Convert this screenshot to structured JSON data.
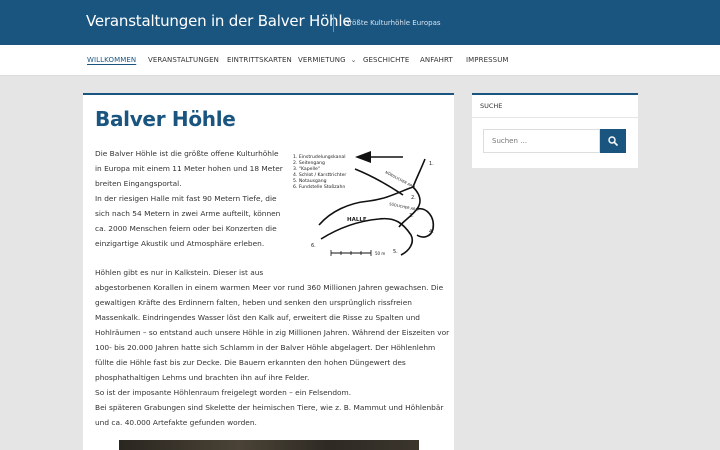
{
  "site": {
    "title": "Veranstaltungen in der Balver Höhle",
    "tagline": "Größte Kulturhöhle Europas"
  },
  "nav": {
    "items": [
      {
        "label": "WILLKOMMEN",
        "active": true
      },
      {
        "label": "VERANSTALTUNGEN"
      },
      {
        "label": "EINTRITTSKARTEN"
      },
      {
        "label": "VERMIETUNG",
        "has_dropdown": true
      },
      {
        "label": "GESCHICHTE"
      },
      {
        "label": "ANFAHRT"
      },
      {
        "label": "IMPRESSUM"
      }
    ]
  },
  "page": {
    "title": "Balver Höhle",
    "intro_lines": [
      "Die Balver Höhle ist die größte offene Kulturhöhle",
      "in Europa mit einem 11 Meter hohen und 18 Meter",
      "breiten Eingangsportal.",
      "In der riesigen Halle mit fast 90 Metern Tiefe, die",
      "sich nach 54 Metern in zwei Arme aufteilt, können",
      "ca. 2000 Menschen feiern oder bei Konzerten die",
      "einzigartige Akustik und Atmosphäre erleben."
    ],
    "body_lines": [
      "Höhlen gibt es nur in Kalkstein. Dieser ist aus",
      "abgestorbenen Korallen in einem warmen Meer vor rund 360 Millionen Jahren gewachsen. Die",
      "gewaltigen Kräfte des Erdinnern falten, heben und senken den ursprünglich rissfreien",
      "Massenkalk. Eindringendes Wasser löst den Kalk auf, erweitert die Risse zu Spalten und",
      "Hohlräumen – so entstand auch unsere Höhle in zig Millionen Jahren. Während der Eiszeiten vor",
      "100- bis 20.000 Jahren hatte sich Schlamm in der Balver Höhle abgelagert. Der Höhlenlehm",
      "füllte die Höhle fast bis zur Decke. Die Bauern erkannten den hohen Düngewert des",
      "phosphathaltigen Lehms und brachten ihn auf ihre Felder.",
      "So ist der imposante Höhlenraum freigelegt worden – ein Felsendom.",
      "Bei späteren Grabungen sind Skelette der heimischen Tiere, wie z. B. Mammut und Höhlenbär",
      "und ca. 40.000 Artefakte gefunden worden."
    ],
    "map": {
      "legend": [
        "1. Einstrudelungskanal",
        "2. Seitengang",
        "3. \"Kapelle\"",
        "4. Schlot / Karsttrichter",
        "5. Notausgang",
        "6. Fundstelle Stoßzahn"
      ],
      "labels": {
        "hall": "HALLE",
        "arm_north": "NÖRDLICHER ARM",
        "arm_south": "SÜDLICHER ARM"
      },
      "numbers": [
        "1.",
        "2.",
        "3.",
        "4.",
        "5.",
        "6."
      ],
      "scale_note": "50 m"
    }
  },
  "sidebar": {
    "widget_title": "SUCHE",
    "search_placeholder": "Suchen …",
    "search_icon": "search-icon"
  },
  "colors": {
    "brand": "#1a5580",
    "background": "#e5e5e5"
  }
}
